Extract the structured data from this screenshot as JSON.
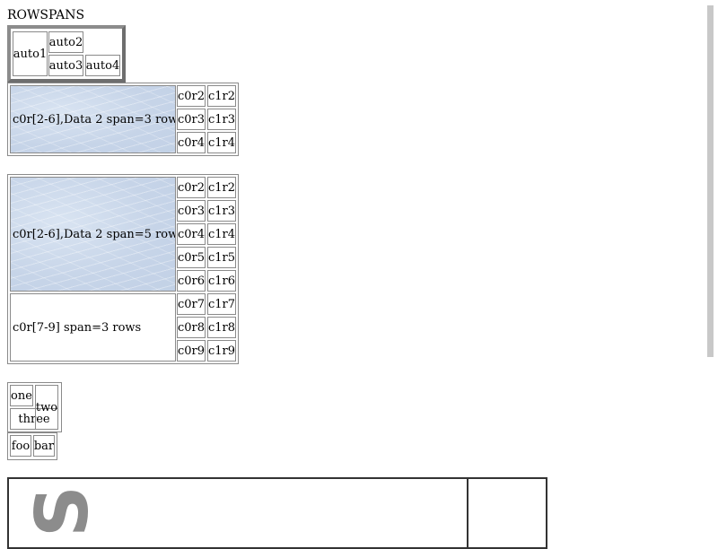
{
  "heading": "ROWSPANS",
  "table_auto": {
    "cells": [
      "auto1",
      "auto2",
      "auto3",
      "auto4"
    ]
  },
  "table_span3": {
    "big": "c0r[2-6],Data 2 span=3 rows",
    "rows": [
      [
        "c0r2",
        "c1r2"
      ],
      [
        "c0r3",
        "c1r3"
      ],
      [
        "c0r4",
        "c1r4"
      ]
    ]
  },
  "table_span5": {
    "big": "c0r[2-6],Data 2 span=5 rows",
    "big2": "c0r[7-9] span=3 rows",
    "rows": [
      [
        "c0r2",
        "c1r2"
      ],
      [
        "c0r3",
        "c1r3"
      ],
      [
        "c0r4",
        "c1r4"
      ],
      [
        "c0r5",
        "c1r5"
      ],
      [
        "c0r6",
        "c1r6"
      ],
      [
        "c0r7",
        "c1r7"
      ],
      [
        "c0r8",
        "c1r8"
      ],
      [
        "c0r9",
        "c1r9"
      ]
    ]
  },
  "table_small": {
    "one": "one",
    "two": "two",
    "three": "three"
  },
  "table_foobar": {
    "cells": [
      "foo",
      "bar"
    ]
  },
  "big_glyph": "S"
}
